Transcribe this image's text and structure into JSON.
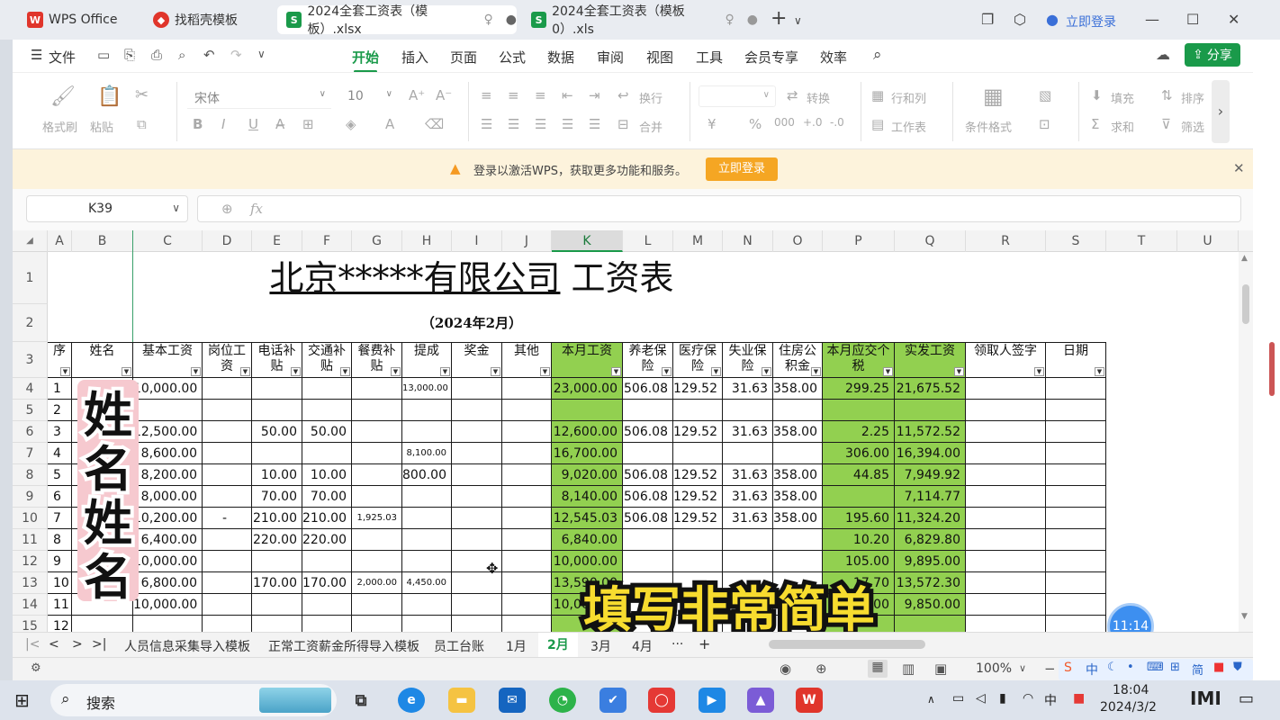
{
  "tabs": {
    "home": "WPS Office",
    "t1": "找稻壳模板",
    "t2": "2024全套工资表（模板）.xlsx",
    "t3": "2024全套工资表（模板0）.xls",
    "login": "立即登录"
  },
  "menu": {
    "file": "文件",
    "items": [
      "开始",
      "插入",
      "页面",
      "公式",
      "数据",
      "审阅",
      "视图",
      "工具",
      "会员专享",
      "效率"
    ],
    "share": "分享"
  },
  "ribbon": {
    "format_painter": "格式刷",
    "paste": "粘贴",
    "font": "宋体",
    "size": "10",
    "wrap": "换行",
    "merge": "合并",
    "convert": "转换",
    "rowcol": "行和列",
    "worksheet": "工作表",
    "condfmt": "条件格式",
    "fill": "填充",
    "sort": "排序",
    "sum": "求和",
    "filter": "筛选"
  },
  "notice": {
    "text": "登录以激活WPS，获取更多功能和服务。",
    "button": "立即登录"
  },
  "formula": {
    "cellref": "K39",
    "fx": "fx"
  },
  "columns": [
    "A",
    "B",
    "C",
    "D",
    "E",
    "F",
    "G",
    "H",
    "I",
    "J",
    "K",
    "L",
    "M",
    "N",
    "O",
    "P",
    "Q",
    "R",
    "S",
    "T",
    "U"
  ],
  "rows": [
    "1",
    "2",
    "3",
    "4",
    "5",
    "6",
    "7",
    "8",
    "9",
    "10",
    "11",
    "12",
    "13",
    "14",
    "15"
  ],
  "sheet": {
    "title_company": "北京*****有限公司",
    "title_suffix": " 工资表",
    "period": "（2024年2月）",
    "headers": {
      "seq": "序",
      "name": "姓名",
      "base": "基本工资",
      "post": "岗位工资",
      "phone": "电话补贴",
      "traffic": "交通补贴",
      "meal": "餐费补贴",
      "comm": "提成",
      "bonus": "奖金",
      "other": "其他",
      "month": "本月工资",
      "pension": "养老保险",
      "medical": "医疗保险",
      "unemp": "失业保险",
      "housing": "住房公积金",
      "tax": "本月应交个税",
      "net": "实发工资",
      "sign": "领取人签字",
      "date": "日期"
    },
    "data": [
      {
        "seq": "1",
        "base": "10,000.00",
        "post": "",
        "phone": "",
        "traffic": "",
        "meal": "",
        "comm": "13,000.00",
        "month": "23,000.00",
        "pension": "506.08",
        "medical": "129.52",
        "unemp": "31.63",
        "housing": "358.00",
        "tax": "299.25",
        "net": "21,675.52"
      },
      {
        "seq": "2",
        "base": "",
        "post": "",
        "phone": "",
        "traffic": "",
        "meal": "",
        "comm": "",
        "month": "",
        "pension": "",
        "medical": "",
        "unemp": "",
        "housing": "",
        "tax": "",
        "net": ""
      },
      {
        "seq": "3",
        "base": "12,500.00",
        "post": "",
        "phone": "50.00",
        "traffic": "50.00",
        "meal": "",
        "comm": "",
        "month": "12,600.00",
        "pension": "506.08",
        "medical": "129.52",
        "unemp": "31.63",
        "housing": "358.00",
        "tax": "2.25",
        "net": "11,572.52"
      },
      {
        "seq": "4",
        "base": "8,600.00",
        "post": "",
        "phone": "",
        "traffic": "",
        "meal": "",
        "comm": "8,100.00",
        "month": "16,700.00",
        "pension": "",
        "medical": "",
        "unemp": "",
        "housing": "",
        "tax": "306.00",
        "net": "16,394.00"
      },
      {
        "seq": "5",
        "base": "8,200.00",
        "post": "",
        "phone": "10.00",
        "traffic": "10.00",
        "meal": "",
        "comm": "800.00",
        "month": "9,020.00",
        "pension": "506.08",
        "medical": "129.52",
        "unemp": "31.63",
        "housing": "358.00",
        "tax": "44.85",
        "net": "7,949.92"
      },
      {
        "seq": "6",
        "base": "8,000.00",
        "post": "",
        "phone": "70.00",
        "traffic": "70.00",
        "meal": "",
        "comm": "",
        "month": "8,140.00",
        "pension": "506.08",
        "medical": "129.52",
        "unemp": "31.63",
        "housing": "358.00",
        "tax": "",
        "net": "7,114.77"
      },
      {
        "seq": "7",
        "base": "10,200.00",
        "post": "-",
        "phone": "210.00",
        "traffic": "210.00",
        "meal": "1,925.03",
        "comm": "",
        "month": "12,545.03",
        "pension": "506.08",
        "medical": "129.52",
        "unemp": "31.63",
        "housing": "358.00",
        "tax": "195.60",
        "net": "11,324.20"
      },
      {
        "seq": "8",
        "base": "6,400.00",
        "post": "",
        "phone": "220.00",
        "traffic": "220.00",
        "meal": "",
        "comm": "",
        "month": "6,840.00",
        "pension": "",
        "medical": "",
        "unemp": "",
        "housing": "",
        "tax": "10.20",
        "net": "6,829.80"
      },
      {
        "seq": "9",
        "base": "10,000.00",
        "post": "",
        "phone": "",
        "traffic": "",
        "meal": "",
        "comm": "",
        "month": "10,000.00",
        "pension": "",
        "medical": "",
        "unemp": "",
        "housing": "",
        "tax": "105.00",
        "net": "9,895.00"
      },
      {
        "seq": "10",
        "base": "6,800.00",
        "post": "",
        "phone": "170.00",
        "traffic": "170.00",
        "meal": "2,000.00",
        "comm": "4,450.00",
        "month": "13,590.00",
        "pension": "",
        "medical": "",
        "unemp": "",
        "housing": "",
        "tax": "17.70",
        "net": "13,572.30"
      },
      {
        "seq": "11",
        "base": "10,000.00",
        "post": "",
        "phone": "",
        "traffic": "",
        "meal": "",
        "comm": "",
        "month": "10,000.00",
        "pension": "",
        "medical": "",
        "unemp": "",
        "housing": "",
        "tax": "150.00",
        "net": "9,850.00"
      },
      {
        "seq": "12",
        "base": "",
        "post": "",
        "phone": "",
        "traffic": "",
        "meal": "",
        "comm": "",
        "month": "",
        "pension": "",
        "medical": "",
        "unemp": "",
        "housing": "",
        "tax": "",
        "net": ""
      }
    ]
  },
  "overlay": {
    "name_sticker": "姓名姓名",
    "caption": "填写非常简单",
    "clock_badge": "11:14"
  },
  "sheettabs": [
    "人员信息采集导入模板",
    "正常工资薪金所得导入模板",
    "员工台账",
    "1月",
    "2月",
    "3月",
    "4月"
  ],
  "status": {
    "zoom": "100%"
  },
  "taskbar": {
    "search": "搜索",
    "ime": "中",
    "time": "18:04",
    "date": "2024/3/2"
  },
  "colors": {
    "accent": "#1a9a4a",
    "green_fill": "#92d050",
    "orange": "#f59a23"
  }
}
